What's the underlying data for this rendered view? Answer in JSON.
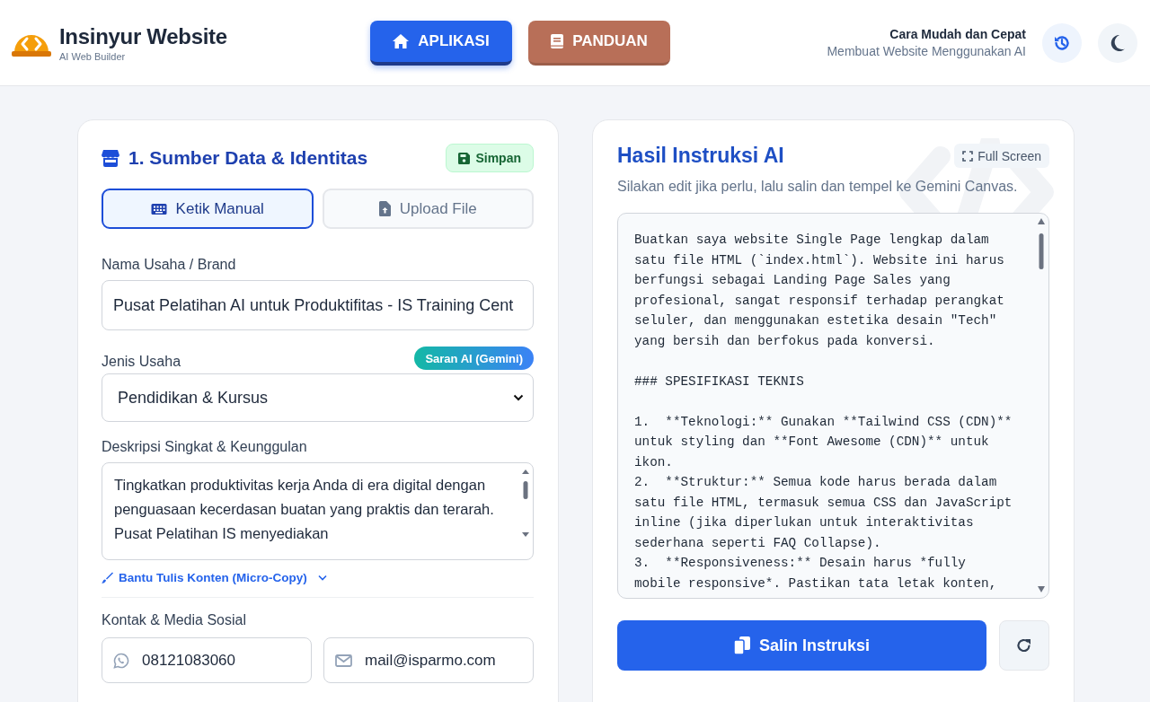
{
  "header": {
    "brand": {
      "title": "Insinyur Website",
      "subtitle": "AI Web Builder"
    },
    "nav": [
      {
        "label": "APLIKASI",
        "kind": "app",
        "selected": true
      },
      {
        "label": "PANDUAN",
        "kind": "guide",
        "selected": false
      }
    ],
    "tagline": {
      "title": "Cara Mudah dan Cepat",
      "subtitle": "Membuat Website Menggunakan AI"
    }
  },
  "source_panel": {
    "title": "1. Sumber Data & Identitas",
    "save_button": "Simpan",
    "modes": [
      {
        "label": "Ketik Manual",
        "kind": "keyboard",
        "selected": true
      },
      {
        "label": "Upload File",
        "kind": "upload",
        "selected": false
      }
    ],
    "business_name": {
      "label": "Nama Usaha / Brand",
      "value": "Pusat Pelatihan AI untuk Produktifitas - IS Training Cent"
    },
    "business_type": {
      "label": "Jenis Usaha",
      "suggest_button": "Saran AI (Gemini)",
      "value": "Pendidikan & Kursus"
    },
    "description": {
      "label": "Deskripsi Singkat & Keunggulan",
      "value": "Tingkatkan produktivitas kerja Anda di era digital dengan penguasaan kecerdasan buatan yang praktis dan terarah. Pusat Pelatihan IS menyediakan"
    },
    "copy_helper": {
      "label": "Bantu Tulis Konten (Micro-Copy)",
      "expanded": false
    },
    "contacts": {
      "label": "Kontak & Media Sosial",
      "fields": [
        {
          "kind": "whatsapp",
          "value": "08121083060"
        },
        {
          "kind": "email",
          "value": "mail@isparmo.com"
        }
      ]
    }
  },
  "result_panel": {
    "title": "Hasil Instruksi AI",
    "fullscreen_button": "Full Screen",
    "hint": "Silakan edit jika perlu, lalu salin dan tempel ke Gemini Canvas.",
    "prompt": "Buatkan saya website Single Page lengkap dalam satu file HTML (`index.html`). Website ini harus berfungsi sebagai Landing Page Sales yang profesional, sangat responsif terhadap perangkat seluler, dan menggunakan estetika desain \"Tech\" yang bersih dan berfokus pada konversi.\n\n### SPESIFIKASI TEKNIS\n\n1.  **Teknologi:** Gunakan **Tailwind CSS (CDN)** untuk styling dan **Font Awesome (CDN)** untuk ikon.\n2.  **Struktur:** Semua kode harus berada dalam satu file HTML, termasuk semua CSS dan JavaScript inline (jika diperlukan untuk interaktivitas sederhana seperti FAQ Collapse).\n3.  **Responsiveness:** Desain harus *fully mobile responsive*. Pastikan tata letak konten,",
    "copy_button": "Salin Instruksi"
  }
}
